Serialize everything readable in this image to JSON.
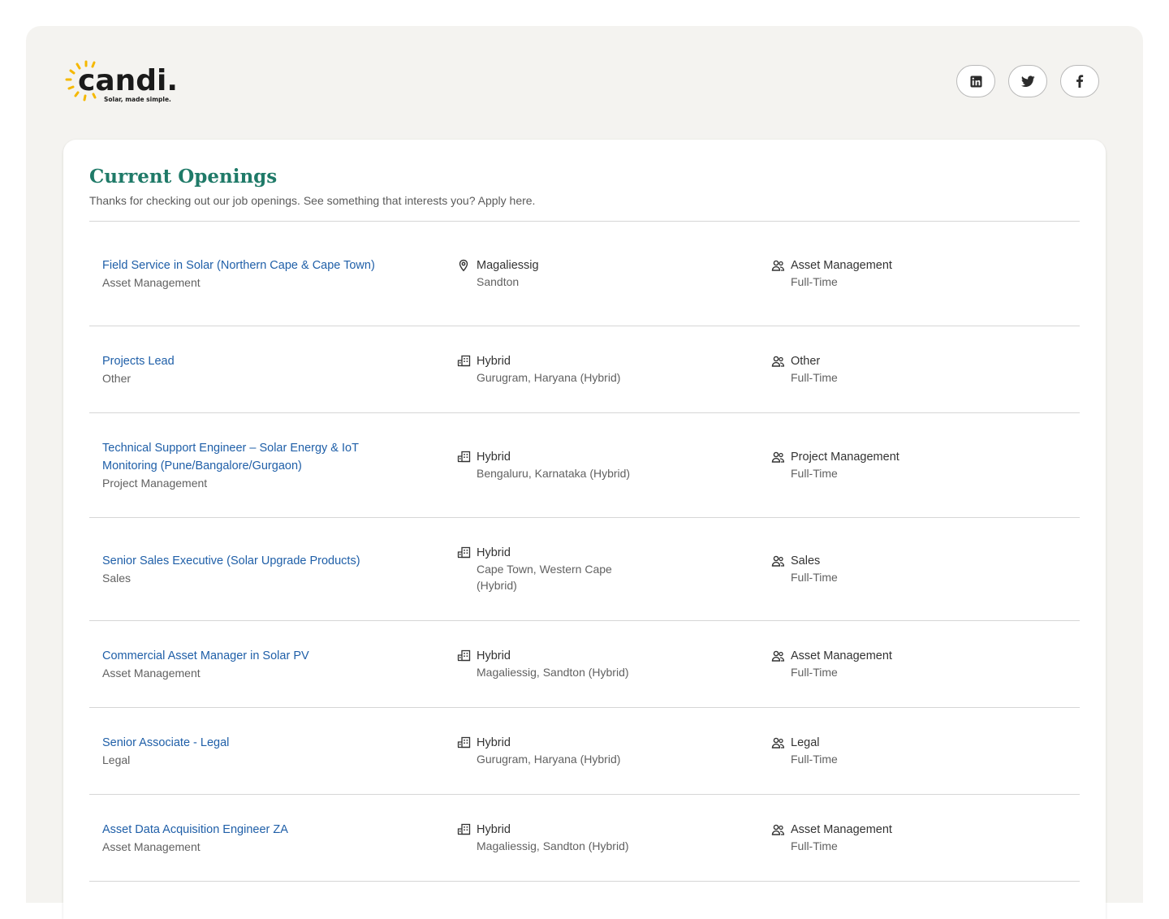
{
  "header": {
    "logo_text": "candi.",
    "logo_tagline": "Solar, made simple.",
    "social": [
      {
        "name": "linkedin",
        "icon": "linkedin-icon"
      },
      {
        "name": "twitter",
        "icon": "twitter-icon"
      },
      {
        "name": "facebook",
        "icon": "facebook-icon"
      }
    ]
  },
  "colors": {
    "title": "#1f7a68",
    "link": "#1f5fa8",
    "page_bg": "#f4f3f0",
    "logo_sun": "#f5b800"
  },
  "openings": {
    "title": "Current Openings",
    "subtitle": "Thanks for checking out our job openings. See something that interests you? Apply here.",
    "jobs": [
      {
        "title": "Field Service in Solar (Northern Cape & Cape Town)",
        "department": "Asset Management",
        "location_icon": "map-pin-icon",
        "location_primary": "Magaliessig",
        "location_secondary": "Sandton",
        "team": "Asset Management",
        "type": "Full-Time"
      },
      {
        "title": "Projects Lead",
        "department": "Other",
        "location_icon": "building-icon",
        "location_primary": "Hybrid",
        "location_secondary": "Gurugram, Haryana (Hybrid)",
        "team": "Other",
        "type": "Full-Time"
      },
      {
        "title": "Technical Support Engineer – Solar Energy & IoT Monitoring (Pune/Bangalore/Gurgaon)",
        "department": "Project Management",
        "location_icon": "building-icon",
        "location_primary": "Hybrid",
        "location_secondary": "Bengaluru, Karnataka (Hybrid)",
        "team": "Project Management",
        "type": "Full-Time"
      },
      {
        "title": "Senior Sales Executive (Solar Upgrade Products)",
        "department": "Sales",
        "location_icon": "building-icon",
        "location_primary": "Hybrid",
        "location_secondary": "Cape Town, Western Cape (Hybrid)",
        "team": "Sales",
        "type": "Full-Time"
      },
      {
        "title": "Commercial Asset Manager in Solar PV",
        "department": "Asset Management",
        "location_icon": "building-icon",
        "location_primary": "Hybrid",
        "location_secondary": "Magaliessig, Sandton (Hybrid)",
        "team": "Asset Management",
        "type": "Full-Time"
      },
      {
        "title": "Senior Associate - Legal",
        "department": "Legal",
        "location_icon": "building-icon",
        "location_primary": "Hybrid",
        "location_secondary": "Gurugram, Haryana (Hybrid)",
        "team": "Legal",
        "type": "Full-Time"
      },
      {
        "title": "Asset Data Acquisition Engineer ZA",
        "department": "Asset Management",
        "location_icon": "building-icon",
        "location_primary": "Hybrid",
        "location_secondary": "Magaliessig, Sandton (Hybrid)",
        "team": "Asset Management",
        "type": "Full-Time"
      }
    ]
  }
}
